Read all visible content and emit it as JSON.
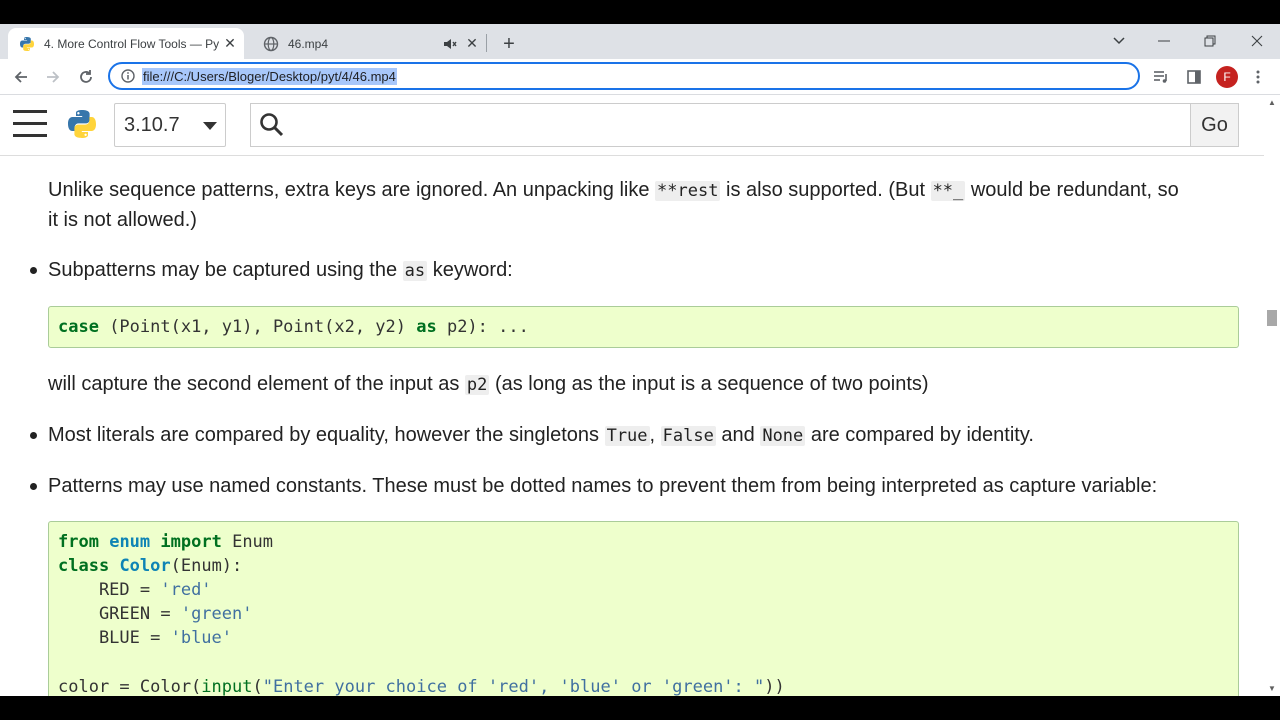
{
  "browser": {
    "tabs": [
      {
        "title": "4. More Control Flow Tools — Py",
        "active": true
      },
      {
        "title": "46.mp4",
        "active": false
      }
    ],
    "url": "file:///C:/Users/Bloger/Desktop/pyt/4/46.mp4",
    "profile_initial": "F"
  },
  "docs": {
    "version": "3.10.7",
    "go_label": "Go"
  },
  "content": {
    "para1_a": "Unlike sequence patterns, extra keys are ignored. An unpacking like ",
    "para1_code1": "**rest",
    "para1_b": " is also supported. (But ",
    "para1_code2": "**_",
    "para1_c": " would be redundant, so",
    "para1_line2": "it is not allowed.)",
    "bullet1_a": "Subpatterns may be captured using the ",
    "bullet1_code": "as",
    "bullet1_b": " keyword:",
    "code1": {
      "kw_case": "case",
      "rest_a": " (Point(x1, y1), Point(x2, y2) ",
      "kw_as": "as",
      "rest_b": " p2): ..."
    },
    "para2_a": "will capture the second element of the input as ",
    "para2_code": "p2",
    "para2_b": " (as long as the input is a sequence of two points)",
    "bullet2_a": "Most literals are compared by equality, however the singletons ",
    "bullet2_code1": "True",
    "bullet2_sep1": ", ",
    "bullet2_code2": "False",
    "bullet2_and": " and ",
    "bullet2_code3": "None",
    "bullet2_b": " are compared by identity.",
    "bullet3": "Patterns may use named constants. These must be dotted names to prevent them from being interpreted as capture variable:",
    "code2": {
      "l1_from": "from",
      "l1_mod": "enum",
      "l1_import": "import",
      "l1_name": "Enum",
      "l2_class": "class",
      "l2_name": "Color",
      "l2_rest": "(Enum):",
      "l3_name": "    RED = ",
      "l3_str": "'red'",
      "l4_name": "    GREEN = ",
      "l4_str": "'green'",
      "l5_name": "    BLUE = ",
      "l5_str": "'blue'",
      "l7_a": "color = Color(",
      "l7_fn": "input",
      "l7_b": "(",
      "l7_str": "\"Enter your choice of 'red', 'blue' or 'green': \"",
      "l7_c": "))"
    }
  }
}
